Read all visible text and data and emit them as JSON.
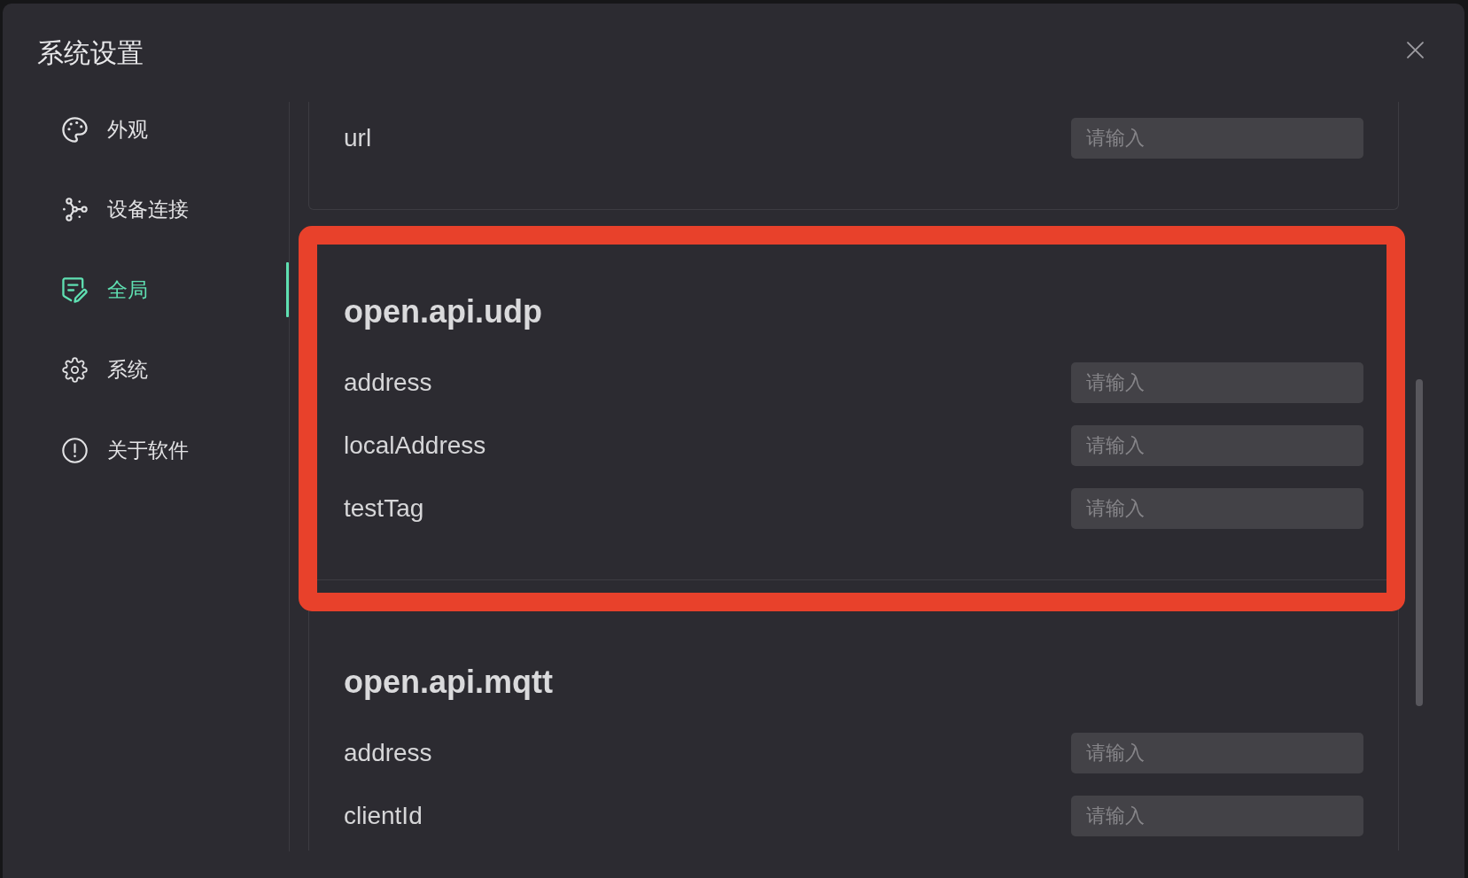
{
  "window": {
    "title": "系统设置"
  },
  "sidebar": {
    "items": [
      {
        "label": "外观",
        "selected": false
      },
      {
        "label": "设备连接",
        "selected": false
      },
      {
        "label": "全局",
        "selected": true
      },
      {
        "label": "系统",
        "selected": false
      },
      {
        "label": "关于软件",
        "selected": false
      }
    ]
  },
  "sections": [
    {
      "highlighted": false,
      "fields": [
        {
          "label": "url",
          "placeholder": "请输入"
        }
      ]
    },
    {
      "title": "open.api.udp",
      "highlighted": true,
      "fields": [
        {
          "label": "address",
          "placeholder": "请输入"
        },
        {
          "label": "localAddress",
          "placeholder": "请输入"
        },
        {
          "label": "testTag",
          "placeholder": "请输入"
        }
      ]
    },
    {
      "title": "open.api.mqtt",
      "highlighted": false,
      "fields": [
        {
          "label": "address",
          "placeholder": "请输入"
        },
        {
          "label": "clientId",
          "placeholder": "请输入"
        }
      ]
    }
  ]
}
